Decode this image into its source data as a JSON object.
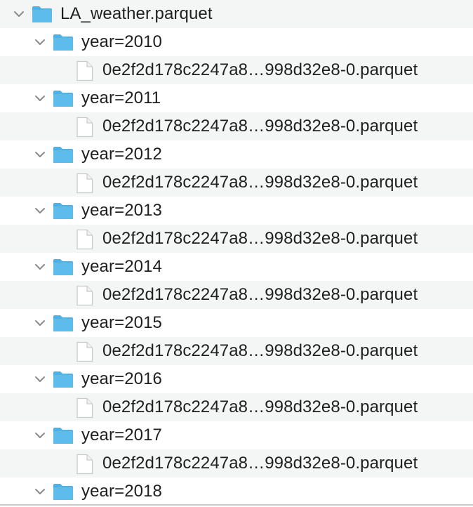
{
  "root": {
    "name": "LA_weather.parquet",
    "expanded": true,
    "icon": "folder-icon"
  },
  "folders": [
    {
      "label": "year=2010",
      "file": "0e2f2d178c2247a8…998d32e8-0.parquet"
    },
    {
      "label": "year=2011",
      "file": "0e2f2d178c2247a8…998d32e8-0.parquet"
    },
    {
      "label": "year=2012",
      "file": "0e2f2d178c2247a8…998d32e8-0.parquet"
    },
    {
      "label": "year=2013",
      "file": "0e2f2d178c2247a8…998d32e8-0.parquet"
    },
    {
      "label": "year=2014",
      "file": "0e2f2d178c2247a8…998d32e8-0.parquet"
    },
    {
      "label": "year=2015",
      "file": "0e2f2d178c2247a8…998d32e8-0.parquet"
    },
    {
      "label": "year=2016",
      "file": "0e2f2d178c2247a8…998d32e8-0.parquet"
    },
    {
      "label": "year=2017",
      "file": "0e2f2d178c2247a8…998d32e8-0.parquet"
    },
    {
      "label": "year=2018"
    }
  ],
  "colors": {
    "folder_fill": "#5ebcec",
    "folder_tab": "#4fb0e2",
    "stripe": "#f4f5f5",
    "chevron": "#8a8a8a",
    "doc_stroke": "#c9c9c9"
  }
}
